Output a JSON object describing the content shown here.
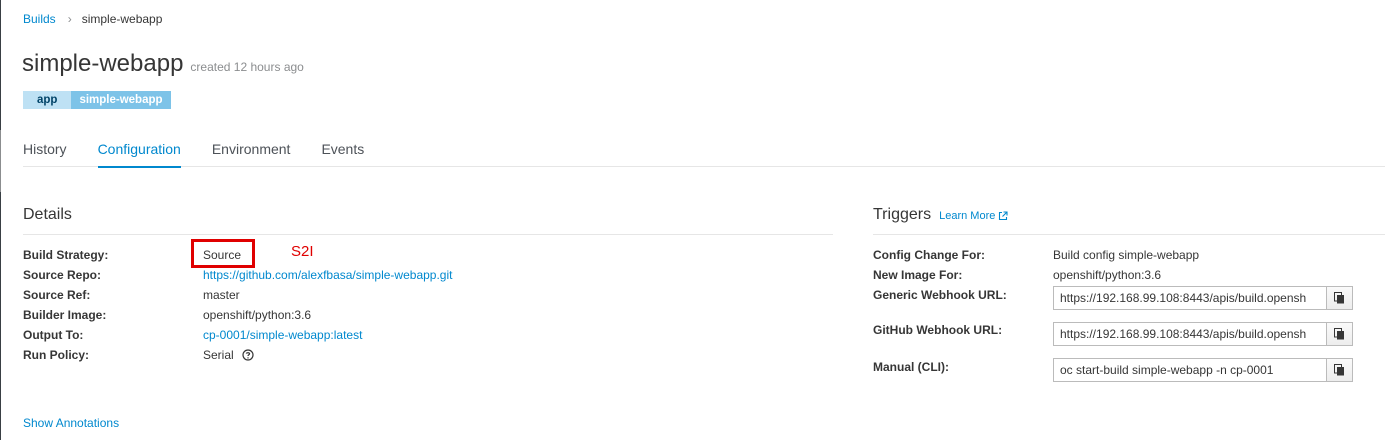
{
  "breadcrumb": {
    "parent": "Builds",
    "current": "simple-webapp"
  },
  "header": {
    "title": "simple-webapp",
    "created": "created 12 hours ago"
  },
  "labels": [
    {
      "key": "app",
      "value": "simple-webapp"
    }
  ],
  "tabs": [
    "History",
    "Configuration",
    "Environment",
    "Events"
  ],
  "active_tab": "Configuration",
  "details": {
    "heading": "Details",
    "build_strategy": {
      "label": "Build Strategy:",
      "value": "Source"
    },
    "source_repo": {
      "label": "Source Repo:",
      "value": "https://github.com/alexfbasa/simple-webapp.git"
    },
    "source_ref": {
      "label": "Source Ref:",
      "value": "master"
    },
    "builder_image": {
      "label": "Builder Image:",
      "value": "openshift/python:3.6"
    },
    "output_to": {
      "label": "Output To:",
      "value": "cp-0001/simple-webapp:latest"
    },
    "run_policy": {
      "label": "Run Policy:",
      "value": "Serial"
    },
    "annotation_note": "S2I"
  },
  "triggers": {
    "heading": "Triggers",
    "learn_more": "Learn More",
    "config_change": {
      "label": "Config Change For:",
      "value": "Build config simple-webapp"
    },
    "new_image": {
      "label": "New Image For:",
      "value": "openshift/python:3.6"
    },
    "generic_webhook": {
      "label": "Generic Webhook URL:",
      "value": "https://192.168.99.108:8443/apis/build.opensh"
    },
    "github_webhook": {
      "label": "GitHub Webhook URL:",
      "value": "https://192.168.99.108:8443/apis/build.opensh"
    },
    "manual_cli": {
      "label": "Manual (CLI):",
      "value": "oc start-build simple-webapp -n cp-0001"
    }
  },
  "show_annotations": "Show Annotations",
  "colors": {
    "link": "#0088ce",
    "label_key_bg": "#bee1f4",
    "label_value_bg": "#7dc3e8",
    "highlight": "#e00000"
  },
  "icons": {
    "separator": "chevron-right-icon",
    "external": "external-link-icon",
    "help": "question-circle-icon",
    "copy": "copy-icon"
  }
}
